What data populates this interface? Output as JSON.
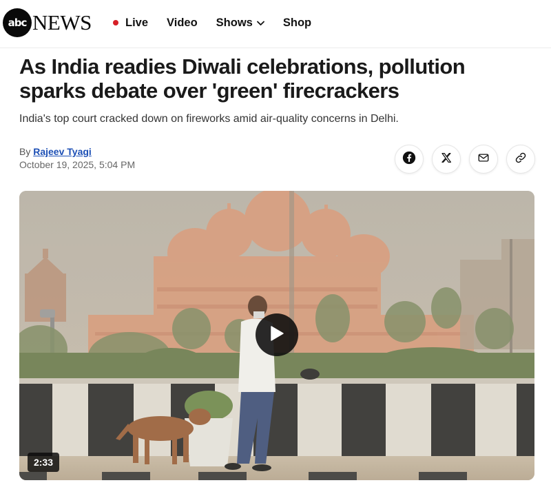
{
  "brand": {
    "logo_mark": "abc",
    "logo_word": "NEWS"
  },
  "nav": {
    "items": [
      {
        "label": "Live",
        "has_dot": true,
        "dot_color": "#d61f26"
      },
      {
        "label": "Video"
      },
      {
        "label": "Shows",
        "has_dropdown": true,
        "dropdown_icon": "chevron-down-icon"
      },
      {
        "label": "Shop"
      }
    ]
  },
  "article": {
    "headline_line1": "As India readies Diwali celebrations, pollution",
    "headline_line2": "sparks debate over 'green' firecrackers",
    "subheadline": "India's top court cracked down on fireworks amid air-quality concerns in Delhi.",
    "byline_prefix": "By",
    "author": "Rajeev Tyagi",
    "date": "October 19, 2025, 5:04 PM"
  },
  "share": {
    "icons": [
      "facebook-icon",
      "x-icon",
      "mail-icon",
      "link-icon"
    ]
  },
  "video": {
    "duration": "2:33",
    "play_icon": "play-icon"
  },
  "colors": {
    "accent_live": "#d61f26",
    "author_link": "#1c4fb5"
  }
}
